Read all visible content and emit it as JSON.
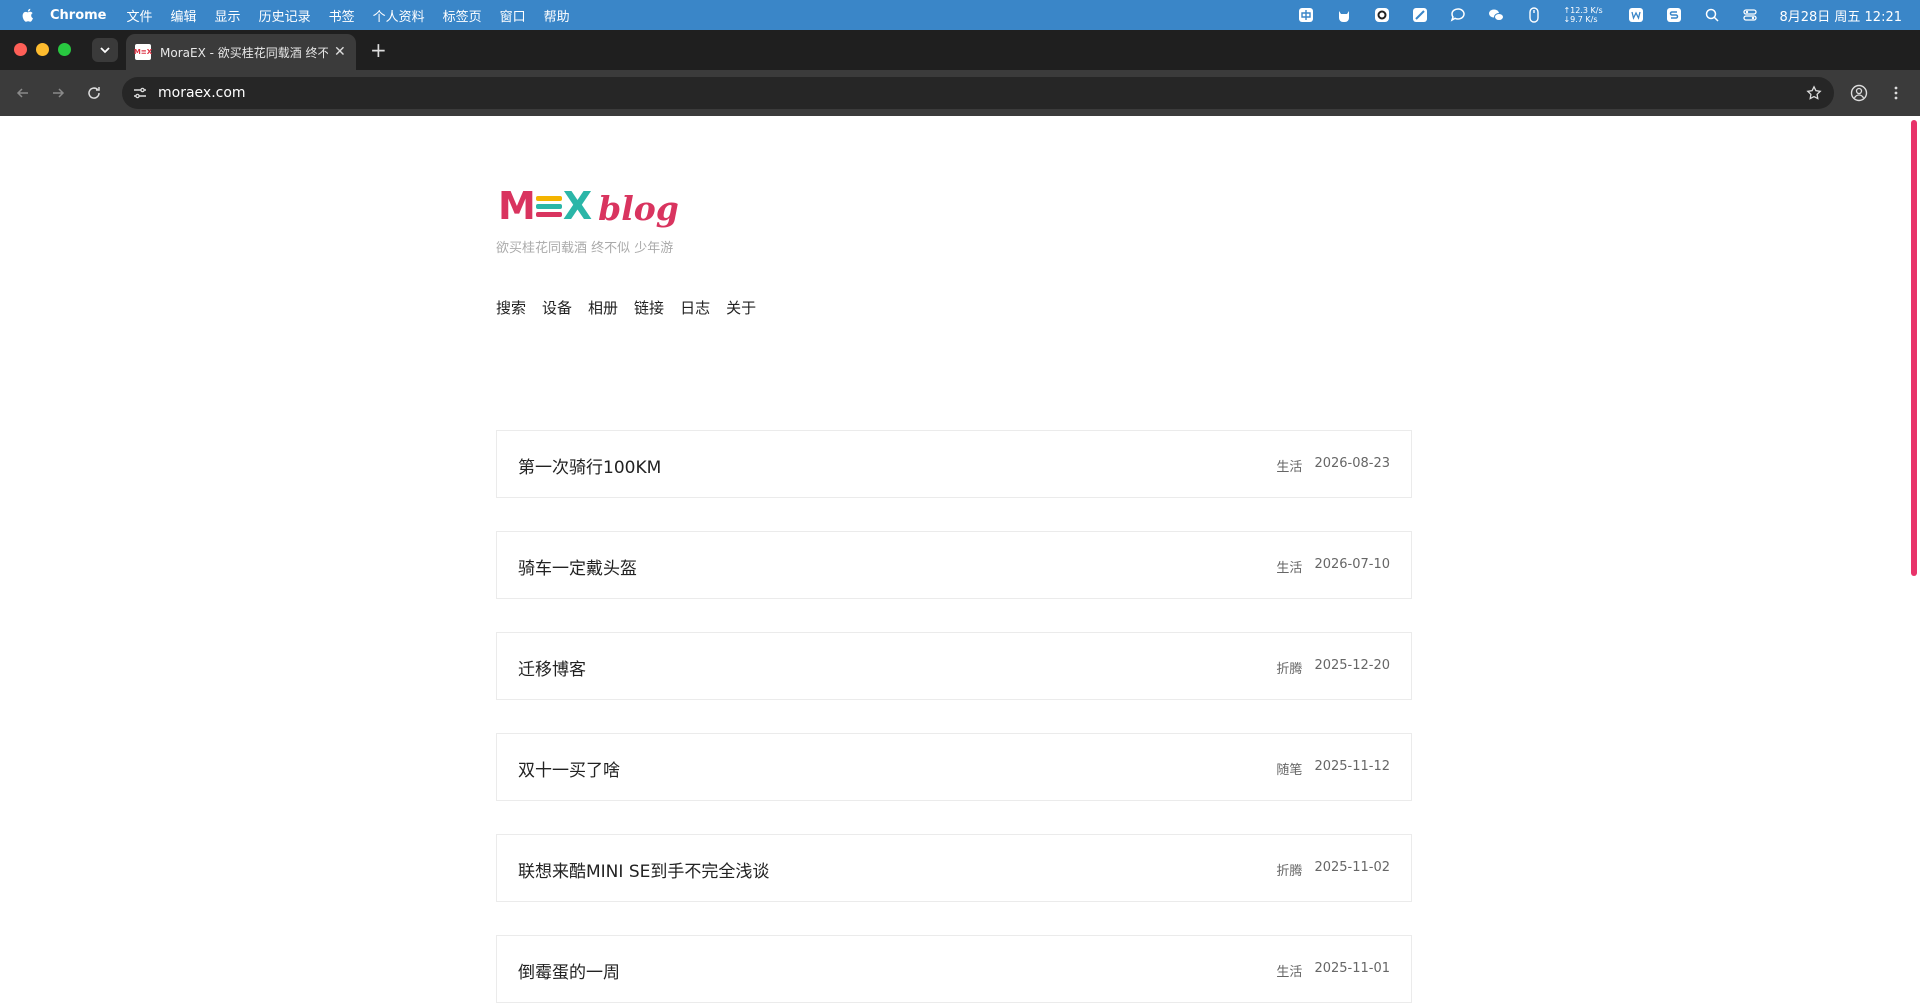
{
  "menubar": {
    "app": "Chrome",
    "items": [
      "文件",
      "编辑",
      "显示",
      "历史记录",
      "书签",
      "个人资料",
      "标签页",
      "窗口",
      "帮助"
    ],
    "net_up": "↑12.3 K/s",
    "net_down": "↓9.7 K/s",
    "datetime": "8月28日 周五  12:21"
  },
  "tabs": [
    {
      "title": "MoraEX - 欲买桂花同载酒 终不似",
      "favicon_text": "M≡X"
    }
  ],
  "toolbar": {
    "url": "moraex.com"
  },
  "site": {
    "logo_m": "M",
    "logo_x": "X",
    "logo_blog": "blog",
    "slogan": "欲买桂花同载酒 终不似 少年游",
    "nav": [
      "搜索",
      "设备",
      "相册",
      "链接",
      "日志",
      "关于"
    ]
  },
  "posts": [
    {
      "title": "第一次骑行100KM",
      "category": "生活",
      "date": "2026-08-23"
    },
    {
      "title": "骑车一定戴头盔",
      "category": "生活",
      "date": "2026-07-10"
    },
    {
      "title": "迁移博客",
      "category": "折腾",
      "date": "2025-12-20"
    },
    {
      "title": "双十一买了啥",
      "category": "随笔",
      "date": "2025-11-12"
    },
    {
      "title": "联想来酷MINI SE到手不完全浅谈",
      "category": "折腾",
      "date": "2025-11-02"
    },
    {
      "title": "倒霉蛋的一周",
      "category": "生活",
      "date": "2025-11-01"
    }
  ],
  "colors": {
    "accent": "#d9345f",
    "teal": "#2bb6a8",
    "menubar": "#3a86c8"
  }
}
